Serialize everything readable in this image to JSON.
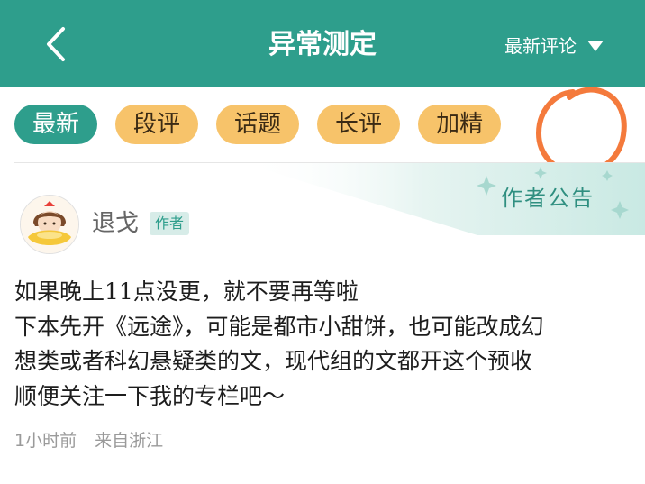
{
  "header": {
    "back_icon": "chevron-left-icon",
    "title": "异常测定",
    "sort_label": "最新评论",
    "sort_icon": "triangle-down-icon"
  },
  "tabs": [
    {
      "label": "最新",
      "active": true
    },
    {
      "label": "段评",
      "active": false
    },
    {
      "label": "话题",
      "active": false
    },
    {
      "label": "长评",
      "active": false
    },
    {
      "label": "加精",
      "active": false
    }
  ],
  "colors": {
    "brand": "#2e9e8c",
    "tab": "#f7c36a",
    "annotation_circle": "#f47a3c"
  },
  "post": {
    "banner_label": "作者公告",
    "username": "退戈",
    "author_badge": "作者",
    "lines": [
      "如果晚上11点没更，就不要再等啦",
      "下本先开《远途》，可能是都市小甜饼，也可能改成幻",
      "想类或者科幻悬疑类的文，现代组的文都开这个预收",
      "顺便关注一下我的专栏吧～"
    ],
    "time": "1小时前",
    "location": "来自浙江"
  }
}
